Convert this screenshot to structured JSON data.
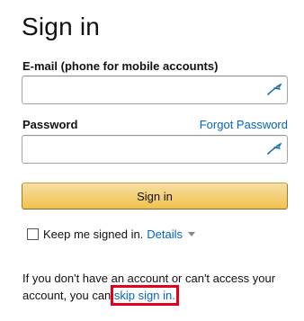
{
  "page": {
    "title": "Sign in"
  },
  "form": {
    "email_label": "E-mail (phone for mobile accounts)",
    "email_value": "",
    "password_label": "Password",
    "password_value": "",
    "forgot_password": "Forgot Password",
    "signin_button": "Sign in",
    "keep_signed_in": "Keep me signed in.",
    "details_link": "Details"
  },
  "help": {
    "text_before": "If you don't have an account or can't access your account, you can ",
    "skip_link": "skip sign in."
  },
  "colors": {
    "link": "#0066c0",
    "button_top": "#f7dfa5",
    "button_bottom": "#f0c14b",
    "highlight_box": "#e2001a"
  },
  "icons": {
    "field_icon": "key-icon",
    "details_caret": "chevron-down-icon"
  }
}
